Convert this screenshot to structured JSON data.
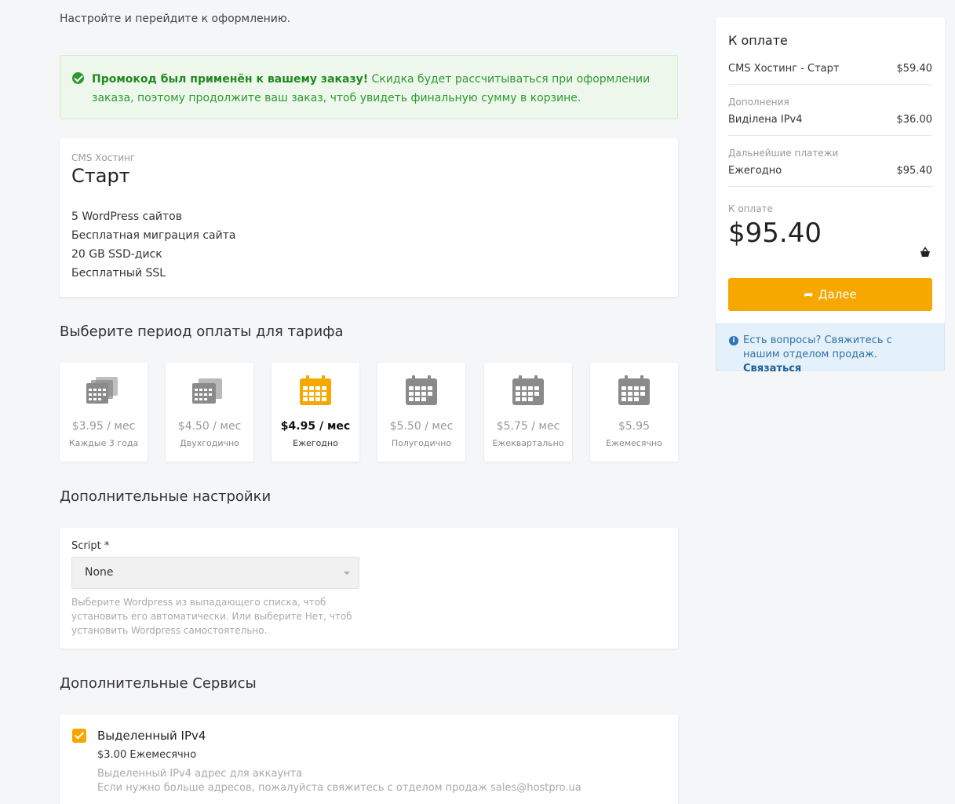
{
  "intro": "Настройте и перейдите к оформлению.",
  "alert": {
    "strong": "Промокод был применён к вашему заказу!",
    "text": " Скидка будет рассчитываться при оформлении заказа, поэтому продолжите ваш заказ, чтоб увидеть финальную сумму в корзине.",
    "color": "#2e9a2e"
  },
  "product": {
    "category": "CMS Хостинг",
    "name": "Старт",
    "features": [
      "5 WordPress сайтов",
      "Бесплатная миграция сайта",
      "20 GB SSD-диск",
      "Бесплатный SSL"
    ]
  },
  "billing": {
    "title": "Выберите период оплаты для тарифа",
    "periods": [
      {
        "price": "$3.95 / мес",
        "label": "Каждые 3 года",
        "icon": "multi-calendar-icon",
        "active": false
      },
      {
        "price": "$4.50 / мес",
        "label": "Двухгодично",
        "icon": "multi-calendar-icon",
        "active": false
      },
      {
        "price": "$4.95 / мес",
        "label": "Ежегодно",
        "icon": "calendar-icon",
        "active": true
      },
      {
        "price": "$5.50 / мес",
        "label": "Полугодично",
        "icon": "calendar-icon",
        "active": false
      },
      {
        "price": "$5.75 / мес",
        "label": "Ежеквартально",
        "icon": "calendar-icon",
        "active": false
      },
      {
        "price": "$5.95",
        "label": "Ежемесячно",
        "icon": "calendar-icon",
        "active": false
      }
    ],
    "active_color": "#f6a800",
    "inactive_color": "#8a8a8a"
  },
  "settings": {
    "title": "Дополнительные настройки",
    "script_label": "Script *",
    "script_value": "None",
    "hint": "Выберите Wordpress из выпадающего списка, чтоб установить его автоматически. Или выберите Нет, чтоб установить Wordpress самостоятельно."
  },
  "services": {
    "title": "Дополнительные Сервисы",
    "item": {
      "name": "Выделенный IPv4",
      "price": "$3.00 Ежемесячно",
      "desc1": "Выделенный IPv4 адрес для аккаунта",
      "desc2": "Если нужно больше адресов, пожалуйста свяжитесь с отделом продаж sales@hostpro.ua",
      "checked": true
    }
  },
  "summary": {
    "title": "К оплате",
    "item_name": "CMS Хостинг - Старт",
    "item_price": "$59.40",
    "addons_label": "Дополнения",
    "addon_name": "Виділена IPv4",
    "addon_price": "$36.00",
    "recurring_label": "Дальнейшие платежи",
    "recurring_name": "Ежегодно",
    "recurring_price": "$95.40",
    "total_label": "К оплате",
    "total": "$95.40",
    "next_button": "Далее",
    "accent": "#f6a800"
  },
  "help": {
    "text": "Есть вопросы? Свяжитесь с нашим отделом продаж.",
    "link": "Связаться"
  }
}
